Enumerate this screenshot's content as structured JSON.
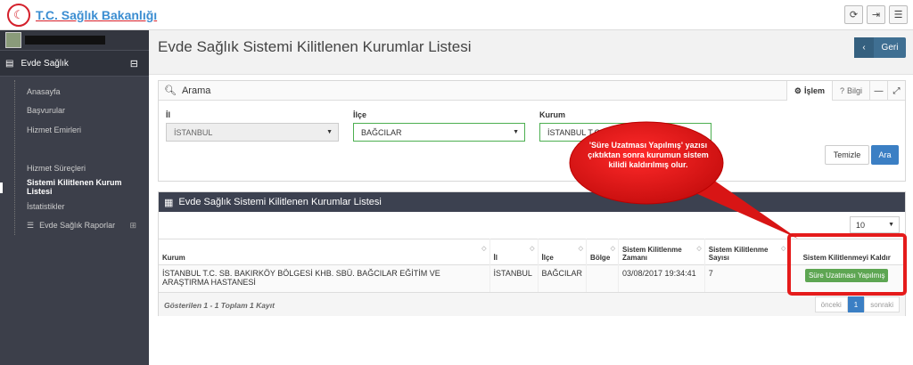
{
  "header": {
    "brand": "T.C. Sağlık Bakanlığı"
  },
  "sidebar": {
    "section_label": "Evde Sağlık",
    "items": [
      {
        "label": "Anasayfa"
      },
      {
        "label": "Başvurular"
      },
      {
        "label": "Hizmet Emirleri"
      },
      {
        "label": ""
      },
      {
        "label": "Hizmet Süreçleri"
      },
      {
        "label": "Sistemi Kilitlenen Kurum Listesi"
      },
      {
        "label": "İstatistikler"
      },
      {
        "label": "Evde Sağlık Raporlar"
      }
    ]
  },
  "page": {
    "title": "Evde Sağlık Sistemi Kilitlenen Kurumlar Listesi",
    "back_label": "Geri"
  },
  "search": {
    "title": "Arama",
    "tab_islem": "İşlem",
    "tab_bilgi": "Bilgi",
    "il_label": "İl",
    "il_value": "İSTANBUL",
    "ilce_label": "İlçe",
    "ilce_value": "BAĞCILAR",
    "kurum_label": "Kurum",
    "kurum_value": "İSTANBUL T.C.",
    "clear_label": "Temizle",
    "search_label": "Ara"
  },
  "list": {
    "title": "Evde Sağlık Sistemi Kilitlenen Kurumlar Listesi",
    "page_size": "10",
    "columns": [
      "Kurum",
      "İl",
      "İlçe",
      "Bölge",
      "Sistem Kilitlenme Zamanı",
      "Sistem Kilitlenme Sayısı",
      "Sistem Kilitlenmeyi Kaldır"
    ],
    "rows": [
      {
        "kurum": "İSTANBUL T.C. SB. BAKIRKÖY BÖLGESİ KHB. SBÜ. BAĞCILAR EĞİTİM VE ARAŞTIRMA HASTANESİ",
        "il": "İSTANBUL",
        "ilce": "BAĞCILAR",
        "bolge": "",
        "zaman": "03/08/2017 19:34:41",
        "sayi": "7",
        "action": "Süre Uzatması Yapılmış"
      }
    ],
    "showing": "Gösterilen 1 - 1 Toplam 1 Kayıt",
    "prev_label": "önceki",
    "current_page": "1",
    "next_label": "sonraki"
  },
  "annotation": {
    "text": "'Süre Uzatması Yapılmış' yazısı çıktıktan sonra kurumun sistem kilidi kaldırılmış olur.",
    "color": "#e51b1b"
  },
  "colors": {
    "sidebar_bg": "#3c3f4a",
    "primary": "#3b7fc4",
    "success": "#5ea653",
    "back_button": "#3f6f92"
  }
}
